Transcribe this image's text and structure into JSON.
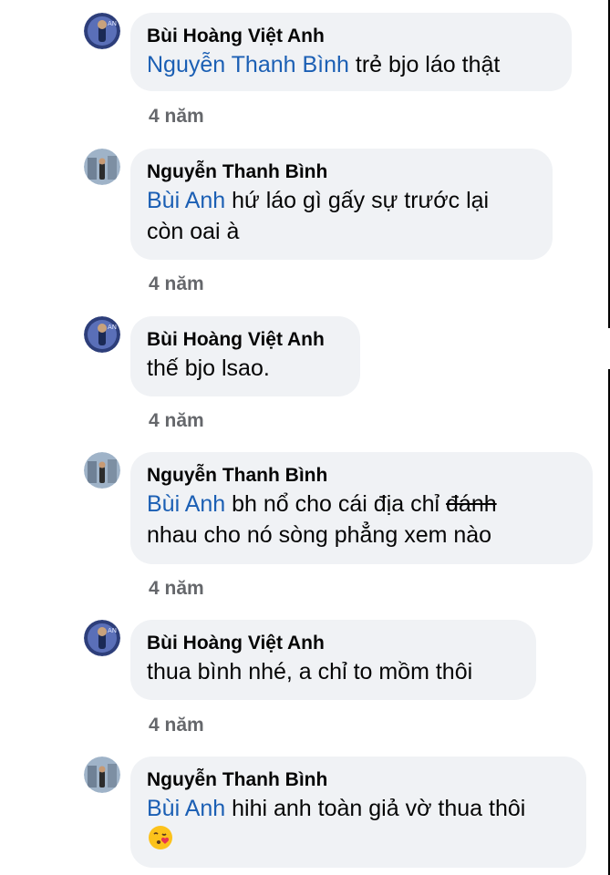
{
  "comments": [
    {
      "author": "Bùi Hoàng Việt Anh",
      "mention": "Nguyễn Thanh Bình",
      "text": " trẻ bjo láo thật",
      "time": "4 năm"
    },
    {
      "author": "Nguyễn Thanh Bình",
      "mention": "Bùi Anh",
      "text_line1": " hứ láo gì gấy sự trước lại",
      "text_line2": "còn oai à",
      "time": "4 năm"
    },
    {
      "author": "Bùi Hoàng Việt Anh",
      "text": "thế bjo lsao.",
      "time": "4 năm"
    },
    {
      "author": "Nguyễn Thanh Bình",
      "mention": "Bùi Anh",
      "text_line1": " bh nổ cho cái địa chỉ ",
      "strike": "đánh",
      "text_line2": "nhau cho nó sòng phẳng xem nào",
      "time": "4 năm"
    },
    {
      "author": "Bùi Hoàng Việt Anh",
      "text": "thua bình nhé, a chỉ to mồm thôi",
      "time": "4 năm"
    },
    {
      "author": "Nguyễn Thanh Bình",
      "mention": "Bùi Anh",
      "text": " hihi anh toàn giả vờ thua thôi",
      "emoji": "face-blowing-kiss-emoji"
    }
  ],
  "colors": {
    "bubble": "#f0f2f5",
    "mention": "#1b5fb4",
    "time": "#65676b",
    "text": "#050505"
  }
}
